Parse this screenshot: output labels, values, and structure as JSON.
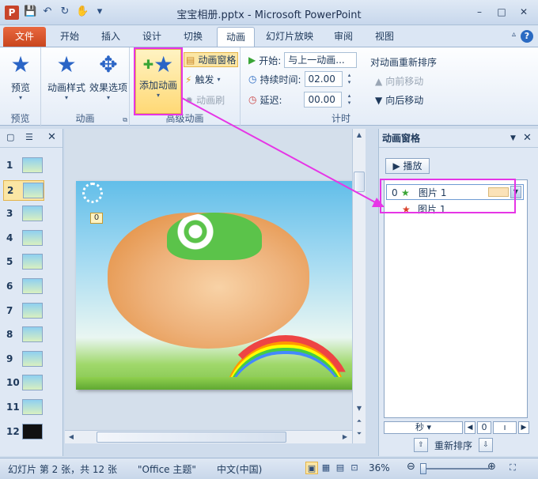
{
  "window": {
    "title": "宝宝相册.pptx - Microsoft PowerPoint",
    "app_icon": "P",
    "controls": {
      "minimize": "–",
      "maximize": "□",
      "close": "✕"
    }
  },
  "qat": {
    "save_icon": "💾",
    "undo_icon": "↶",
    "redo_icon": "↻",
    "repeat_icon": "✋",
    "customize_icon": "▾"
  },
  "tabs": [
    {
      "label": "文件"
    },
    {
      "label": "开始"
    },
    {
      "label": "插入"
    },
    {
      "label": "设计"
    },
    {
      "label": "切换"
    },
    {
      "label": "动画"
    },
    {
      "label": "幻灯片放映"
    },
    {
      "label": "审阅"
    },
    {
      "label": "视图"
    }
  ],
  "ribbon": {
    "preview": {
      "button": "预览",
      "group": "预览"
    },
    "animation": {
      "style_button": "动画样式",
      "effect_button": "效果选项",
      "group": "动画"
    },
    "advanced": {
      "add_animation": "添加动画",
      "pane": "动画窗格",
      "trigger": "触发",
      "painter": "动画刷",
      "group": "高级动画"
    },
    "timing": {
      "start_label": "开始:",
      "start_value": "与上一动画...",
      "duration_label": "持续时间:",
      "duration_value": "02.00",
      "delay_label": "延迟:",
      "delay_value": "00.00",
      "reorder_title": "对动画重新排序",
      "move_earlier": "向前移动",
      "move_later": "向后移动",
      "group": "计时"
    }
  },
  "thumbnails": [
    {
      "num": "1"
    },
    {
      "num": "2"
    },
    {
      "num": "3"
    },
    {
      "num": "4"
    },
    {
      "num": "5"
    },
    {
      "num": "6"
    },
    {
      "num": "7"
    },
    {
      "num": "8"
    },
    {
      "num": "9"
    },
    {
      "num": "10"
    },
    {
      "num": "11"
    },
    {
      "num": "12"
    }
  ],
  "slide": {
    "anim_tag": "0"
  },
  "anim_pane": {
    "title": "动画窗格",
    "play": "播放",
    "items": [
      {
        "index": "0",
        "label": "图片 1"
      },
      {
        "index": "",
        "label": "图片 1"
      }
    ],
    "time_unit": "秒",
    "time_value": "0",
    "reorder_label": "重新排序"
  },
  "status": {
    "slide_info": "幻灯片 第 2 张，共 12 张",
    "theme": "\"Office 主题\"",
    "language": "中文(中国)",
    "zoom": "36%"
  },
  "colors": {
    "accent_highlight": "#e635e6",
    "file_tab": "#d9532b"
  }
}
